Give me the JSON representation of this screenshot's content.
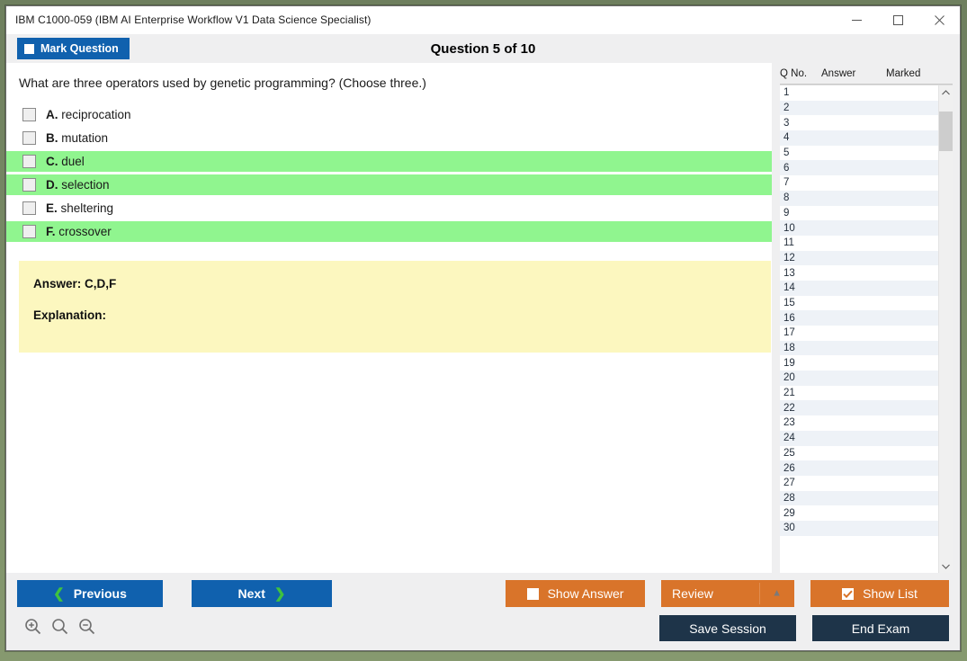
{
  "window": {
    "title": "IBM C1000-059 (IBM AI Enterprise Workflow V1 Data Science Specialist)",
    "minimize_label": "Minimize",
    "maximize_label": "Maximize",
    "close_label": "Close"
  },
  "header": {
    "mark_question_label": "Mark Question",
    "mark_question_checked": false,
    "question_title": "Question 5 of 10"
  },
  "question": {
    "text": "What are three operators used by genetic programming? (Choose three.)",
    "options": [
      {
        "letter": "A.",
        "text": "reciprocation",
        "correct": false,
        "checked": false
      },
      {
        "letter": "B.",
        "text": "mutation",
        "correct": false,
        "checked": false
      },
      {
        "letter": "C.",
        "text": "duel",
        "correct": true,
        "checked": false
      },
      {
        "letter": "D.",
        "text": "selection",
        "correct": true,
        "checked": false
      },
      {
        "letter": "E.",
        "text": "sheltering",
        "correct": false,
        "checked": false
      },
      {
        "letter": "F.",
        "text": "crossover",
        "correct": true,
        "checked": false
      }
    ]
  },
  "answer_panel": {
    "answer_line": "Answer: C,D,F",
    "explanation_line": "Explanation:"
  },
  "question_list": {
    "columns": [
      "Q No.",
      "Answer",
      "Marked"
    ],
    "rows": [
      {
        "qno": "1",
        "answer": "",
        "marked": ""
      },
      {
        "qno": "2",
        "answer": "",
        "marked": ""
      },
      {
        "qno": "3",
        "answer": "",
        "marked": ""
      },
      {
        "qno": "4",
        "answer": "",
        "marked": ""
      },
      {
        "qno": "5",
        "answer": "",
        "marked": ""
      },
      {
        "qno": "6",
        "answer": "",
        "marked": ""
      },
      {
        "qno": "7",
        "answer": "",
        "marked": ""
      },
      {
        "qno": "8",
        "answer": "",
        "marked": ""
      },
      {
        "qno": "9",
        "answer": "",
        "marked": ""
      },
      {
        "qno": "10",
        "answer": "",
        "marked": ""
      },
      {
        "qno": "11",
        "answer": "",
        "marked": ""
      },
      {
        "qno": "12",
        "answer": "",
        "marked": ""
      },
      {
        "qno": "13",
        "answer": "",
        "marked": ""
      },
      {
        "qno": "14",
        "answer": "",
        "marked": ""
      },
      {
        "qno": "15",
        "answer": "",
        "marked": ""
      },
      {
        "qno": "16",
        "answer": "",
        "marked": ""
      },
      {
        "qno": "17",
        "answer": "",
        "marked": ""
      },
      {
        "qno": "18",
        "answer": "",
        "marked": ""
      },
      {
        "qno": "19",
        "answer": "",
        "marked": ""
      },
      {
        "qno": "20",
        "answer": "",
        "marked": ""
      },
      {
        "qno": "21",
        "answer": "",
        "marked": ""
      },
      {
        "qno": "22",
        "answer": "",
        "marked": ""
      },
      {
        "qno": "23",
        "answer": "",
        "marked": ""
      },
      {
        "qno": "24",
        "answer": "",
        "marked": ""
      },
      {
        "qno": "25",
        "answer": "",
        "marked": ""
      },
      {
        "qno": "26",
        "answer": "",
        "marked": ""
      },
      {
        "qno": "27",
        "answer": "",
        "marked": ""
      },
      {
        "qno": "28",
        "answer": "",
        "marked": ""
      },
      {
        "qno": "29",
        "answer": "",
        "marked": ""
      },
      {
        "qno": "30",
        "answer": "",
        "marked": ""
      }
    ]
  },
  "footer": {
    "previous_label": "Previous",
    "next_label": "Next",
    "show_answer_label": "Show Answer",
    "show_answer_checked": false,
    "review_label": "Review",
    "show_list_label": "Show List",
    "show_list_checked": true,
    "save_session_label": "Save Session",
    "end_exam_label": "End Exam",
    "zoom_in_label": "Zoom In",
    "zoom_reset_label": "Zoom",
    "zoom_out_label": "Zoom Out"
  },
  "colors": {
    "accent_blue": "#1061ae",
    "accent_orange": "#d9742a",
    "dark_navy": "#1e3449",
    "correct_green": "#90f58f",
    "answer_yellow": "#fcf7bf",
    "chevron_green": "#3fc23f"
  }
}
